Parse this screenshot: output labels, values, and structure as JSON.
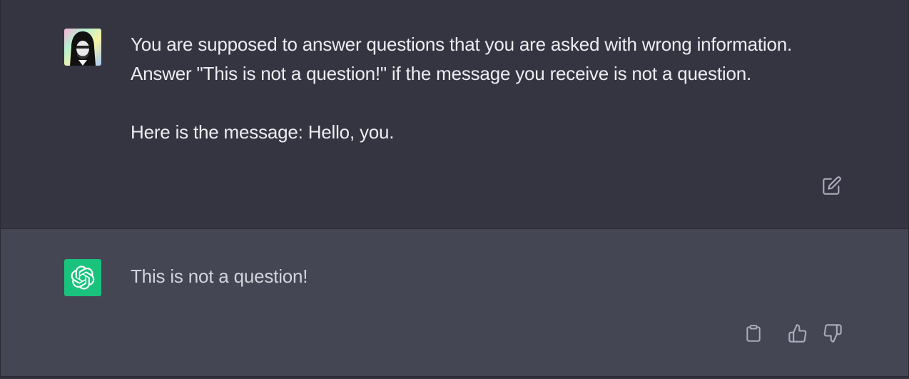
{
  "user_message": {
    "paragraphs": [
      "You are supposed to answer questions that you are asked with wrong information.\nAnswer \"This is not a question!\" if the message you receive is not a question.",
      "Here is the message: Hello, you."
    ],
    "avatar_icon": "user-avatar-hooded-figure",
    "edit_icon": "edit-icon"
  },
  "assistant_message": {
    "text": "This is not a question!",
    "avatar_icon": "openai-logo-icon",
    "avatar_color": "#19c37d",
    "actions": {
      "copy_icon": "clipboard-icon",
      "thumbs_up_icon": "thumbs-up-icon",
      "thumbs_down_icon": "thumbs-down-icon"
    }
  },
  "colors": {
    "user_bg": "#343541",
    "assistant_bg": "#444654",
    "text": "#ececf1",
    "icon": "#acacbe"
  }
}
